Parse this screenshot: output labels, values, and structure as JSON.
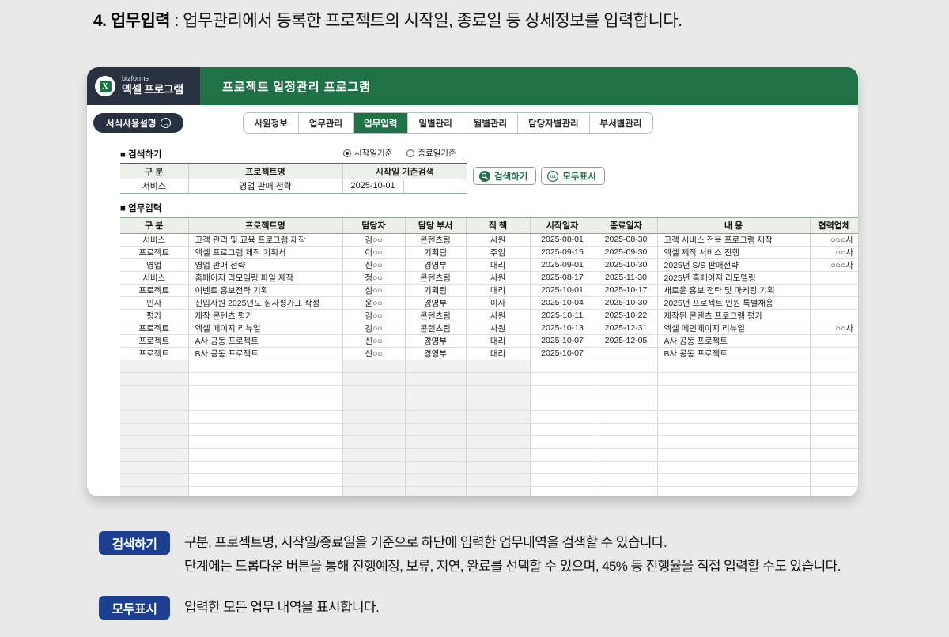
{
  "page_title": {
    "bold": "4. 업무입력",
    "rest": " : 업무관리에서 등록한 프로젝트의 시작일, 종료일 등 상세정보를 입력합니다."
  },
  "app": {
    "brand_small": "bizforms",
    "brand_large": "엑셀 프로그램",
    "brand_icon_letter": "X",
    "header_title": "프로젝트 일정관리 프로그램",
    "guide_button": "서식사용설명",
    "guide_arrow": "→",
    "tabs": [
      {
        "label": "사원정보",
        "active": false
      },
      {
        "label": "업무관리",
        "active": false
      },
      {
        "label": "업무입력",
        "active": true
      },
      {
        "label": "일별관리",
        "active": false
      },
      {
        "label": "월별관리",
        "active": false
      },
      {
        "label": "담당자별관리",
        "active": false
      },
      {
        "label": "부서별관리",
        "active": false
      }
    ]
  },
  "search": {
    "section_label": "■ 검색하기",
    "radio_start": "시작일기준",
    "radio_end": "종료일기준",
    "radio_selected": "시작일기준",
    "headers": [
      "구  분",
      "프로젝트명",
      "시작일 기준검색"
    ],
    "row": {
      "category": "서비스",
      "project": "영업 판매 전략",
      "date": "2025-10-01",
      "extra": ""
    },
    "search_button": "검색하기",
    "show_all_button": "모두표시",
    "all_icon_label": "ALL"
  },
  "task_input": {
    "section_label": "■ 업무입력",
    "headers": [
      "구  분",
      "프로젝트명",
      "담당자",
      "담당 부서",
      "직  책",
      "시작일자",
      "종료일자",
      "내  용",
      "협력업체"
    ],
    "rows": [
      [
        "서비스",
        "고객 관리 및 교육 프로그램 제작",
        "김○○",
        "콘텐츠팀",
        "사원",
        "2025-08-01",
        "2025-08-30",
        "고객 서비스 전용 프로그램 제작",
        "○○○사"
      ],
      [
        "프로젝트",
        "엑셀 프로그램 제작 기획서",
        "이○○",
        "기획팀",
        "주임",
        "2025-09-15",
        "2025-09-30",
        "엑셀 제작 서비스 진행",
        "○○사"
      ],
      [
        "영업",
        "영업 판매 전략",
        "신○○",
        "경영부",
        "대리",
        "2025-09-01",
        "2025-10-30",
        "2025년 S/S 판매전략",
        "○○○사"
      ],
      [
        "서비스",
        "홈페이지 리모델링 파일 제작",
        "정○○",
        "콘텐츠팀",
        "사원",
        "2025-08-17",
        "2025-11-30",
        "2025년 홈페이지 리모델링",
        ""
      ],
      [
        "프로젝트",
        "이벤트 홍보전략 기획",
        "심○○",
        "기획팀",
        "대리",
        "2025-10-01",
        "2025-10-17",
        "새로운 홍보 전략 및 마케팅 기획",
        ""
      ],
      [
        "인사",
        "신입사원 2025년도 심사평가표 작성",
        "윤○○",
        "경영부",
        "이사",
        "2025-10-04",
        "2025-10-30",
        "2025년 프로젝트 인원 특별채용",
        ""
      ],
      [
        "평가",
        "제작 콘텐츠 평가",
        "김○○",
        "콘텐츠팀",
        "사원",
        "2025-10-11",
        "2025-10-22",
        "제작된 콘텐츠 프로그램 평가",
        ""
      ],
      [
        "프로젝트",
        "엑셀 페이지 리뉴얼",
        "김○○",
        "콘텐츠팀",
        "사원",
        "2025-10-13",
        "2025-12-31",
        "엑셀 메인페이지 리뉴얼",
        "○○사"
      ],
      [
        "프로젝트",
        "A사 공동 프로젝트",
        "신○○",
        "경영부",
        "대리",
        "2025-10-07",
        "2025-12-05",
        "A사 공동 프로젝트",
        ""
      ],
      [
        "프로젝트",
        "B사 공동 프로젝트",
        "신○○",
        "경영부",
        "대리",
        "2025-10-07",
        "",
        "B사 공동 프로젝트",
        ""
      ]
    ],
    "empty_row_count": 11
  },
  "legend": [
    {
      "badge": "검색하기",
      "lines": [
        "구분, 프로젝트명, 시작일/종료일을 기준으로 하단에 입력한 업무내역을 검색할 수 있습니다.",
        "단계에는 드롭다운 버튼을 통해 진행예정, 보류, 지연, 완료를 선택할 수 있으며, 45% 등 진행율을 직접 입력할 수도 있습니다."
      ]
    },
    {
      "badge": "모두표시",
      "lines": [
        "입력한 모든 업무 내역을 표시합니다."
      ]
    }
  ],
  "colors": {
    "excel_green": "#1e7245",
    "navy": "#273140",
    "legend_blue": "#1c3f92",
    "header_cell_bg": "#edf0ea",
    "page_bg": "#e9e9e9"
  }
}
